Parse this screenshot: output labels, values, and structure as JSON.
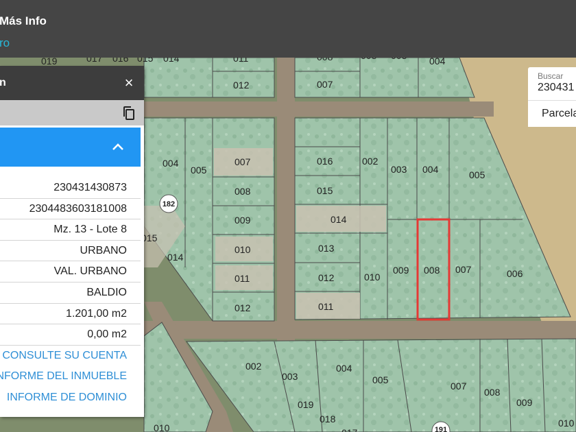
{
  "header": {
    "title": "Más Info",
    "subtitle": "ro"
  },
  "panel": {
    "title": "n",
    "close_icon": "×",
    "rows": [
      "230431430873",
      "2304483603181008",
      "Mz. 13 - Lote 8",
      "URBANO",
      "VAL. URBANO",
      "BALDIO",
      "1.201,00 m2",
      "0,00 m2"
    ],
    "links": [
      "CONSULTE SU CUENTA",
      "INFORME DEL INMUEBLE",
      "INFORME DE DOMINIO"
    ]
  },
  "search": {
    "label": "Buscar",
    "value": "230431",
    "dropdown_value": "Parcela"
  },
  "map": {
    "badges": [
      "182",
      "191"
    ],
    "lots": [
      "019",
      "017",
      "016",
      "015",
      "014",
      "011",
      "008",
      "008",
      "003",
      "004",
      "012",
      "007",
      "004",
      "005",
      "007",
      "008",
      "009",
      "010",
      "011",
      "012",
      "015",
      "014",
      "016",
      "002",
      "003",
      "004",
      "005",
      "015",
      "014",
      "013",
      "012",
      "011",
      "010",
      "009",
      "008",
      "007",
      "006",
      "002",
      "003",
      "004",
      "005",
      "019",
      "018",
      "017",
      "007",
      "008",
      "009",
      "010",
      "010"
    ],
    "selected_lot": "008",
    "colors": {
      "lot_fill": "#a9cdb5",
      "lot_border": "#4a4a4a",
      "highlight": "#e53935",
      "road": "#9c8a78",
      "field": "#c9b78c"
    }
  }
}
